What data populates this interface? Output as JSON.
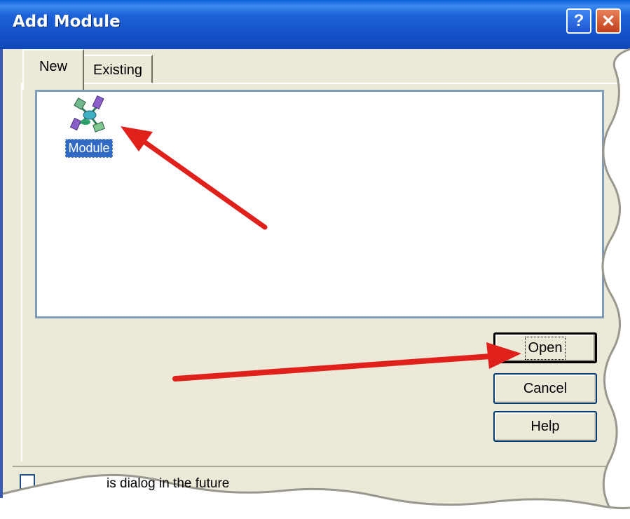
{
  "window": {
    "title": "Add Module",
    "help_glyph": "?",
    "close_glyph": "✕"
  },
  "tabs": [
    {
      "label": "New",
      "selected": true
    },
    {
      "label": "Existing",
      "selected": false
    }
  ],
  "list_view": {
    "items": [
      {
        "label": "Module",
        "icon": "module-icon",
        "selected": true
      }
    ]
  },
  "buttons": {
    "open": "Open",
    "cancel": "Cancel",
    "help": "Help"
  },
  "footer": {
    "checkbox_checked": false,
    "checkbox_label_visible": "is dialog in the future"
  },
  "annotations": {
    "arrow_color": "#e0201a",
    "arrows": [
      "arrow-to-module-icon",
      "arrow-to-open-button"
    ]
  },
  "colors": {
    "titlebar": "#1552c8",
    "dialog_bg": "#ece9d8",
    "selection": "#316ac5"
  }
}
